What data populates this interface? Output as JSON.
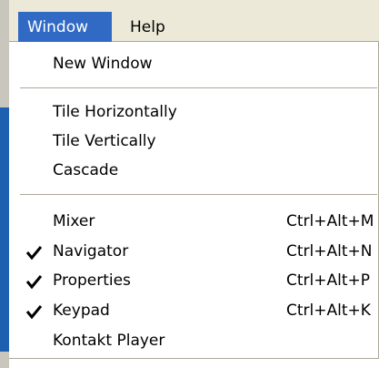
{
  "menubar": {
    "window_label": "Window",
    "help_label": "Help"
  },
  "colors": {
    "highlight": "#316ac5",
    "menubar_bg": "#ece9d8",
    "separator": "#aca899"
  },
  "menu": {
    "new_window": "New Window",
    "tile_horizontally": "Tile Horizontally",
    "tile_vertically": "Tile Vertically",
    "cascade": "Cascade",
    "mixer": {
      "label": "Mixer",
      "shortcut": "Ctrl+Alt+M",
      "checked": false
    },
    "navigator": {
      "label": "Navigator",
      "shortcut": "Ctrl+Alt+N",
      "checked": true
    },
    "properties": {
      "label": "Properties",
      "shortcut": "Ctrl+Alt+P",
      "checked": true
    },
    "keypad": {
      "label": "Keypad",
      "shortcut": "Ctrl+Alt+K",
      "checked": true
    },
    "kontakt_player": {
      "label": "Kontakt Player",
      "shortcut": "",
      "checked": false
    }
  },
  "icons": {
    "check": "check-icon"
  }
}
